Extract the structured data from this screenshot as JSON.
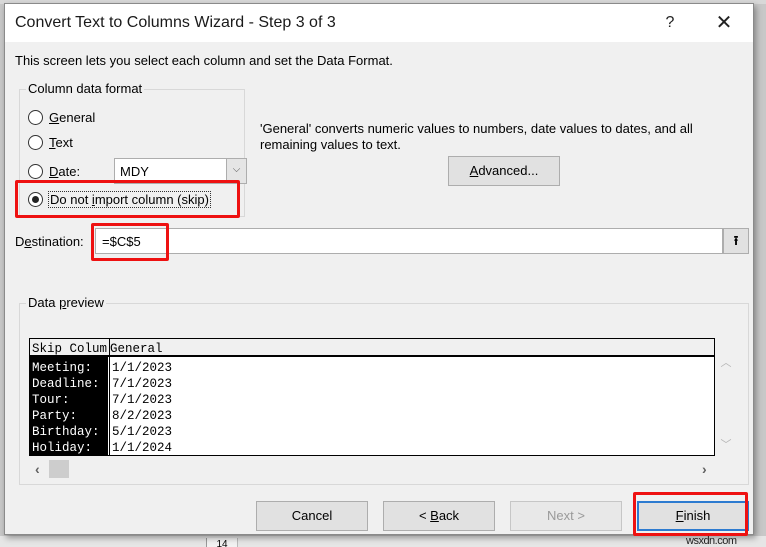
{
  "dialog": {
    "title": "Convert Text to Columns Wizard - Step 3 of 3",
    "help_label": "?",
    "close_label": "✕",
    "intro": "This screen lets you select each column and set the Data Format."
  },
  "column_format": {
    "legend": "Column data format",
    "options": [
      {
        "label": "General",
        "accel": "G",
        "rest": "eneral",
        "checked": false
      },
      {
        "label": "Text",
        "accel": "T",
        "rest": "ext",
        "checked": false
      },
      {
        "label": "Date:",
        "accel": "D",
        "rest": "ate:",
        "checked": false
      },
      {
        "label": "Do not import column (skip)",
        "pre": "Do not ",
        "accel": "i",
        "rest": "mport column (skip)",
        "checked": true
      }
    ],
    "date_select": {
      "value": "MDY",
      "arrow": "⌵"
    }
  },
  "description": "'General' converts numeric values to numbers, date values to dates, and all remaining values to text.",
  "advanced_button": {
    "accel": "A",
    "rest": "dvanced..."
  },
  "destination": {
    "label_pre": "D",
    "label_accel": "e",
    "label_rest": "stination:",
    "value": "=$C$5",
    "collapse_icon": "⭱"
  },
  "preview": {
    "legend_pre": "Data ",
    "legend_accel": "p",
    "legend_rest": "review",
    "headers": [
      "Skip Colum",
      "General"
    ],
    "rows": [
      [
        "Meeting:",
        "1/1/2023"
      ],
      [
        "Deadline:",
        "7/1/2023"
      ],
      [
        "Tour:",
        "7/1/2023"
      ],
      [
        "Party:",
        "8/2/2023"
      ],
      [
        "Birthday:",
        "5/1/2023"
      ],
      [
        "Holiday:",
        "1/1/2024"
      ]
    ],
    "scroll_up": "︿",
    "scroll_down": "﹀",
    "scroll_left": "‹",
    "scroll_right": "›"
  },
  "buttons": {
    "cancel": "Cancel",
    "back_pre": "< ",
    "back_accel": "B",
    "back_rest": "ack",
    "next": "Next >",
    "finish_accel": "F",
    "finish_rest": "inish"
  },
  "background": {
    "row_number": "14"
  },
  "watermark": "wsxdn.com",
  "colors": {
    "highlight": "#ee1111",
    "default_button_border": "#2d7bd0"
  }
}
